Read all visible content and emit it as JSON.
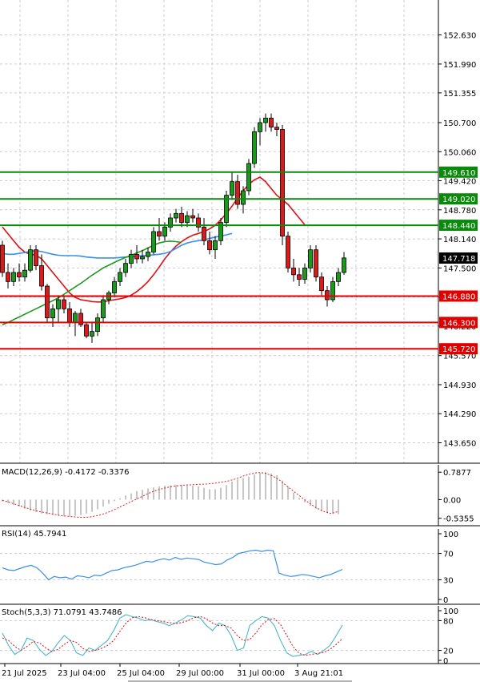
{
  "chart_data": [
    {
      "type": "candlestick",
      "title": "",
      "y_ticks": [
        "152.630",
        "151.990",
        "151.355",
        "150.700",
        "150.060",
        "149.420",
        "148.780",
        "148.140",
        "147.500",
        "146.860",
        "146.220",
        "145.570",
        "144.930",
        "144.290",
        "143.650"
      ],
      "ylim": [
        143.2,
        153.4
      ],
      "current_price": "147.718",
      "horizontal_levels": [
        {
          "value": "149.610",
          "color": "#0a8a0a"
        },
        {
          "value": "149.020",
          "color": "#0a8a0a"
        },
        {
          "value": "148.440",
          "color": "#0a8a0a"
        },
        {
          "value": "146.880",
          "color": "#e00000"
        },
        {
          "value": "146.300",
          "color": "#e00000"
        },
        {
          "value": "145.720",
          "color": "#e00000"
        }
      ],
      "candles": [
        [
          148.0,
          148.1,
          147.3,
          147.4
        ],
        [
          147.4,
          147.6,
          147.05,
          147.2
        ],
        [
          147.2,
          147.5,
          147.1,
          147.4
        ],
        [
          147.4,
          147.6,
          147.2,
          147.3
        ],
        [
          147.3,
          147.6,
          147.2,
          147.45
        ],
        [
          147.45,
          148.0,
          147.4,
          147.9
        ],
        [
          147.9,
          148.0,
          147.45,
          147.55
        ],
        [
          147.55,
          147.8,
          147.0,
          147.1
        ],
        [
          147.1,
          147.15,
          146.3,
          146.4
        ],
        [
          146.4,
          146.7,
          146.2,
          146.6
        ],
        [
          146.6,
          146.9,
          146.3,
          146.8
        ],
        [
          146.8,
          146.9,
          146.5,
          146.6
        ],
        [
          146.6,
          146.75,
          146.2,
          146.3
        ],
        [
          146.3,
          146.55,
          146.0,
          146.5
        ],
        [
          146.5,
          146.6,
          146.2,
          146.25
        ],
        [
          146.25,
          146.3,
          145.95,
          146.0
        ],
        [
          146.0,
          146.3,
          145.85,
          146.1
        ],
        [
          146.1,
          146.5,
          146.0,
          146.4
        ],
        [
          146.4,
          146.9,
          146.3,
          146.8
        ],
        [
          146.8,
          147.0,
          146.7,
          146.95
        ],
        [
          146.95,
          147.3,
          146.85,
          147.2
        ],
        [
          147.2,
          147.5,
          147.1,
          147.4
        ],
        [
          147.4,
          147.7,
          147.3,
          147.6
        ],
        [
          147.6,
          147.9,
          147.5,
          147.8
        ],
        [
          147.8,
          148.0,
          147.6,
          147.7
        ],
        [
          147.7,
          147.9,
          147.6,
          147.75
        ],
        [
          147.75,
          147.95,
          147.65,
          147.85
        ],
        [
          147.85,
          148.4,
          147.8,
          148.3
        ],
        [
          148.3,
          148.6,
          148.1,
          148.2
        ],
        [
          148.2,
          148.5,
          148.1,
          148.4
        ],
        [
          148.4,
          148.7,
          148.3,
          148.6
        ],
        [
          148.6,
          148.8,
          148.5,
          148.7
        ],
        [
          148.7,
          148.85,
          148.4,
          148.5
        ],
        [
          148.5,
          148.75,
          148.4,
          148.65
        ],
        [
          148.65,
          148.8,
          148.5,
          148.6
        ],
        [
          148.6,
          148.7,
          148.3,
          148.4
        ],
        [
          148.4,
          148.6,
          148.0,
          148.1
        ],
        [
          148.1,
          148.3,
          147.8,
          147.9
        ],
        [
          147.9,
          148.2,
          147.7,
          148.1
        ],
        [
          148.1,
          148.6,
          148.0,
          148.5
        ],
        [
          148.5,
          149.2,
          148.4,
          149.1
        ],
        [
          149.1,
          149.6,
          149.0,
          149.4
        ],
        [
          149.4,
          149.55,
          148.8,
          148.9
        ],
        [
          148.9,
          149.3,
          148.7,
          149.2
        ],
        [
          149.2,
          149.9,
          149.1,
          149.8
        ],
        [
          149.8,
          150.6,
          149.7,
          150.5
        ],
        [
          150.5,
          150.8,
          150.2,
          150.7
        ],
        [
          150.7,
          150.9,
          150.5,
          150.8
        ],
        [
          150.8,
          150.9,
          150.5,
          150.6
        ],
        [
          150.6,
          150.7,
          150.4,
          150.55
        ],
        [
          150.55,
          150.65,
          148.0,
          148.2
        ],
        [
          148.2,
          148.3,
          147.4,
          147.5
        ],
        [
          147.5,
          147.7,
          147.2,
          147.35
        ],
        [
          147.35,
          147.5,
          147.1,
          147.25
        ],
        [
          147.25,
          147.6,
          147.15,
          147.5
        ],
        [
          147.5,
          148.0,
          147.4,
          147.9
        ],
        [
          147.9,
          148.0,
          147.2,
          147.3
        ],
        [
          147.3,
          147.4,
          146.9,
          147.0
        ],
        [
          147.0,
          147.1,
          146.65,
          146.8
        ],
        [
          146.8,
          147.3,
          146.75,
          147.2
        ],
        [
          147.2,
          147.5,
          147.1,
          147.4
        ],
        [
          147.4,
          147.85,
          147.35,
          147.72
        ]
      ],
      "moving_averages": [
        {
          "color": "#e01010",
          "values": [
            148.4,
            148.25,
            148.1,
            147.95,
            147.85,
            147.8,
            147.78,
            147.7,
            147.55,
            147.4,
            147.25,
            147.1,
            146.95,
            146.85,
            146.8,
            146.78,
            146.76,
            146.75,
            146.75,
            146.78,
            146.8,
            146.82,
            146.85,
            146.9,
            146.98,
            147.08,
            147.2,
            147.35,
            147.52,
            147.7,
            147.85,
            147.98,
            148.08,
            148.16,
            148.22,
            148.26,
            148.3,
            148.36,
            148.44,
            148.56,
            148.7,
            148.86,
            149.04,
            149.2,
            149.34,
            149.44,
            149.5,
            149.4,
            149.25,
            149.1,
            149.0,
            148.9,
            148.75,
            148.6,
            148.45
          ]
        },
        {
          "color": "#3a8fe8",
          "values": [
            147.82,
            147.8,
            147.8,
            147.82,
            147.84,
            147.87,
            147.88,
            147.86,
            147.83,
            147.8,
            147.78,
            147.77,
            147.77,
            147.77,
            147.76,
            147.74,
            147.73,
            147.72,
            147.72,
            147.72,
            147.72,
            147.73,
            147.74,
            147.75,
            147.76,
            147.77,
            147.78,
            147.79,
            147.8,
            147.82,
            147.86,
            147.93,
            148.0,
            148.05,
            148.08,
            148.1,
            148.12,
            148.15,
            148.18,
            148.2,
            148.23,
            148.26
          ]
        },
        {
          "color": "#1f9a1f",
          "values": [
            146.25,
            146.3,
            146.36,
            146.42,
            146.48,
            146.54,
            146.6,
            146.66,
            146.72,
            146.78,
            146.84,
            146.92,
            147.0,
            147.08,
            147.16,
            147.25,
            147.34,
            147.42,
            147.5,
            147.56,
            147.62,
            147.68,
            147.73,
            147.78,
            147.83,
            147.88,
            147.94,
            148.0,
            148.05,
            148.08,
            148.09,
            148.08,
            148.06
          ]
        }
      ]
    },
    {
      "type": "bar",
      "title": "MACD(12,26,9) -0.4172 -0.3376",
      "y_ticks": [
        "0.7877",
        "0.00",
        "-0.5355"
      ],
      "ylim": [
        -0.75,
        1.0
      ],
      "histogram": [
        -0.05,
        -0.1,
        -0.16,
        -0.2,
        -0.26,
        -0.32,
        -0.36,
        -0.4,
        -0.42,
        -0.44,
        -0.46,
        -0.47,
        -0.47,
        -0.46,
        -0.44,
        -0.4,
        -0.35,
        -0.28,
        -0.2,
        -0.12,
        -0.04,
        0.04,
        0.12,
        0.18,
        0.24,
        0.28,
        0.32,
        0.35,
        0.38,
        0.4,
        0.41,
        0.42,
        0.42,
        0.41,
        0.4,
        0.38,
        0.34,
        0.3,
        0.3,
        0.34,
        0.42,
        0.52,
        0.58,
        0.62,
        0.66,
        0.72,
        0.77,
        0.79,
        0.75,
        0.7,
        0.55,
        0.38,
        0.2,
        0.05,
        -0.08,
        -0.18,
        -0.26,
        -0.33,
        -0.38,
        -0.4,
        -0.42
      ],
      "signal": [
        -0.02,
        -0.08,
        -0.15,
        -0.22,
        -0.28,
        -0.34,
        -0.38,
        -0.42,
        -0.46,
        -0.48,
        -0.5,
        -0.51,
        -0.5,
        -0.46,
        -0.4,
        -0.32,
        -0.22,
        -0.12,
        -0.02,
        0.08,
        0.18,
        0.26,
        0.32,
        0.37,
        0.4,
        0.42,
        0.43,
        0.44,
        0.45,
        0.47,
        0.5,
        0.54,
        0.6,
        0.68,
        0.74,
        0.78,
        0.76,
        0.68,
        0.55,
        0.38,
        0.22,
        0.06,
        -0.1,
        -0.24,
        -0.34,
        -0.4,
        -0.34
      ]
    },
    {
      "type": "line",
      "title": "RSI(14) 45.7941",
      "y_ticks": [
        "100",
        "70",
        "30",
        "0"
      ],
      "ylim": [
        0,
        100
      ],
      "values": [
        48,
        45,
        44,
        47,
        50,
        52,
        48,
        40,
        30,
        35,
        33,
        34,
        31,
        36,
        35,
        33,
        37,
        36,
        40,
        44,
        45,
        48,
        50,
        52,
        55,
        58,
        57,
        60,
        62,
        60,
        64,
        61,
        63,
        62,
        61,
        57,
        55,
        53,
        54,
        60,
        64,
        70,
        72,
        74,
        75,
        73,
        75,
        74,
        40,
        37,
        35,
        36,
        38,
        37,
        35,
        33,
        36,
        38,
        42,
        45.79
      ]
    },
    {
      "type": "line",
      "title": "Stoch(5,3,3) 71.0791 43.7486",
      "y_ticks": [
        "100",
        "80",
        "20",
        "0"
      ],
      "ylim": [
        0,
        100
      ],
      "series": [
        {
          "color": "#48b8c8",
          "values": [
            55,
            30,
            12,
            20,
            45,
            40,
            22,
            10,
            18,
            35,
            50,
            40,
            15,
            10,
            25,
            20,
            30,
            40,
            60,
            85,
            92,
            88,
            85,
            80,
            82,
            78,
            75,
            70,
            75,
            82,
            90,
            88,
            85,
            70,
            60,
            75,
            70,
            50,
            20,
            25,
            70,
            80,
            88,
            85,
            70,
            40,
            15,
            8,
            10,
            12,
            18,
            12,
            20,
            30,
            50,
            71
          ]
        },
        {
          "color": "#e02020",
          "values": [
            45,
            40,
            28,
            20,
            28,
            38,
            35,
            25,
            18,
            22,
            32,
            40,
            36,
            24,
            18,
            20,
            24,
            30,
            40,
            58,
            75,
            86,
            88,
            86,
            82,
            80,
            78,
            76,
            74,
            76,
            80,
            86,
            88,
            84,
            75,
            70,
            70,
            65,
            50,
            40,
            42,
            55,
            72,
            82,
            84,
            72,
            50,
            28,
            14,
            10,
            12,
            14,
            16,
            22,
            32,
            43.75
          ]
        }
      ]
    }
  ],
  "x_ticks": [
    "21 Jul 2025",
    "23 Jul 04:00",
    "25 Jul 04:00",
    "29 Jul 00:00",
    "31 Jul 00:00",
    "3 Aug 21:01"
  ],
  "colors": {
    "bull": "#1a9a1a",
    "bear": "#dd1a1a",
    "grid": "#c8ccd6",
    "axis": "#000000",
    "macd_hist": "#b8b8b8"
  }
}
